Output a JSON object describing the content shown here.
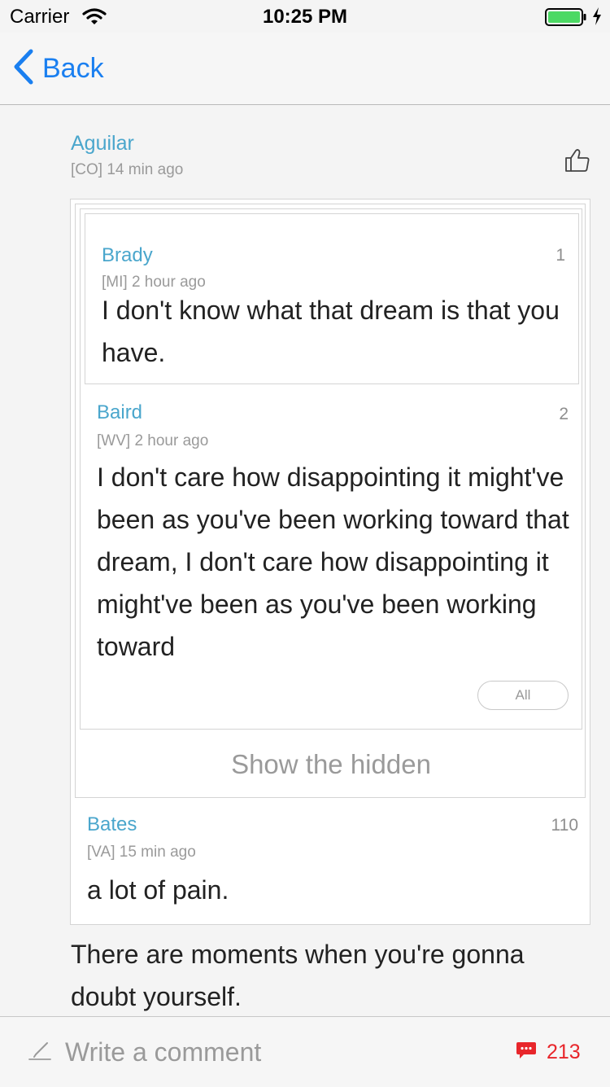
{
  "status_bar": {
    "carrier": "Carrier",
    "time": "10:25 PM"
  },
  "nav": {
    "back_label": "Back"
  },
  "comment": {
    "author": "Aguilar",
    "meta": "[CO] 14 min ago",
    "text": "There are moments when you're gonna doubt yourself.",
    "quoted": [
      {
        "author": "Brady",
        "meta": "[MI] 2 hour ago",
        "floor": "1",
        "text": "I don't know what that dream is that you have."
      },
      {
        "author": "Baird",
        "meta": "[WV] 2 hour ago",
        "floor": "2",
        "text": "I don't care how disappointing it might've been as you've been working toward that dream, I don't care how disappointing it might've been as you've been working toward",
        "expand_label": "All"
      },
      {
        "author": "Bates",
        "meta": "[VA] 15 min ago",
        "floor": "110",
        "text": "a lot of pain."
      }
    ],
    "show_hidden_label": "Show the hidden"
  },
  "bottom_bar": {
    "placeholder": "Write a comment",
    "comment_count": "213"
  },
  "colors": {
    "accent_blue": "#1a7ff0",
    "name_blue": "#4aa6cc",
    "count_red": "#e8262b",
    "battery_green": "#4cd964"
  }
}
